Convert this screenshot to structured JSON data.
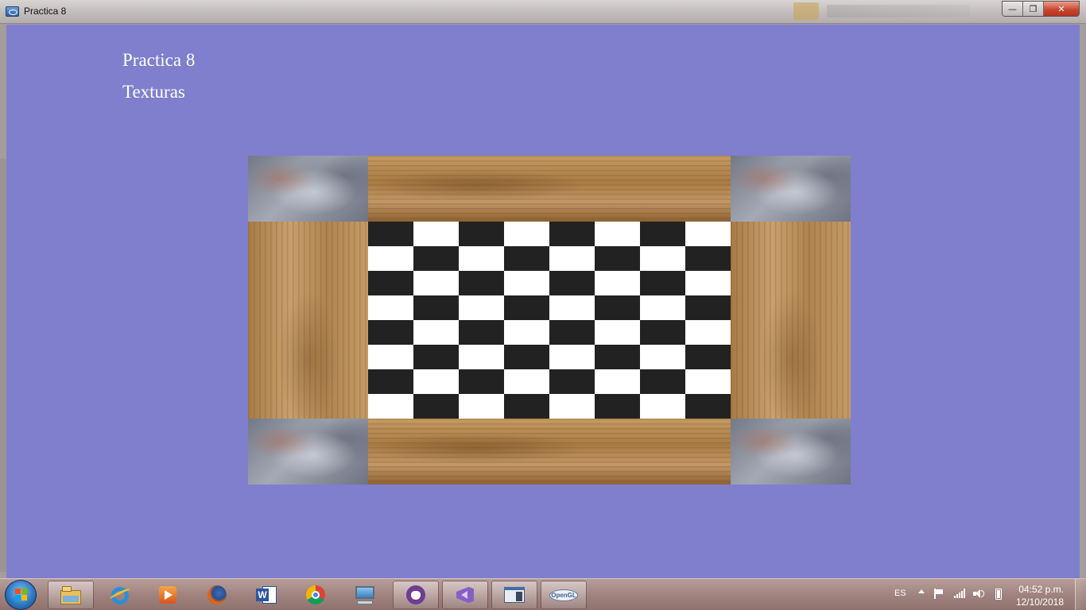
{
  "window": {
    "title": "Practica 8",
    "icon": "app-window-icon",
    "controls": [
      "minimize-icon",
      "maximize-icon",
      "close-icon"
    ]
  },
  "scene": {
    "line1": "Practica 8",
    "line2": "Texturas",
    "board": {
      "corner_texture": "stone",
      "edge_texture": "wood",
      "center_texture": "checkerboard",
      "checker_columns": 8,
      "checker_rows": 8,
      "checker_colors": [
        "#222222",
        "#ffffff"
      ]
    }
  },
  "colors": {
    "background": "#7f7fce",
    "text": "#ffffff"
  },
  "taskbar": {
    "start": "windows-start-icon",
    "pinned": [
      {
        "icon": "file-explorer-icon",
        "active": true
      },
      {
        "icon": "internet-explorer-icon",
        "active": false
      },
      {
        "icon": "media-player-icon",
        "active": false
      },
      {
        "icon": "firefox-icon",
        "active": false
      },
      {
        "icon": "word-icon",
        "active": false
      },
      {
        "icon": "chrome-icon",
        "active": false
      },
      {
        "icon": "remote-desktop-icon",
        "active": false
      },
      {
        "icon": "github-desktop-icon",
        "active": true
      },
      {
        "icon": "visual-studio-icon",
        "active": true
      },
      {
        "icon": "console-window-icon",
        "active": true
      },
      {
        "icon": "opengl-app-icon",
        "active": true
      }
    ],
    "tray": {
      "language": "ES",
      "icons": [
        "show-hidden-icons-icon",
        "action-center-flag-icon",
        "network-signal-icon",
        "volume-icon",
        "battery-icon"
      ],
      "time": "04:52 p.m.",
      "date": "12/10/2018"
    }
  }
}
